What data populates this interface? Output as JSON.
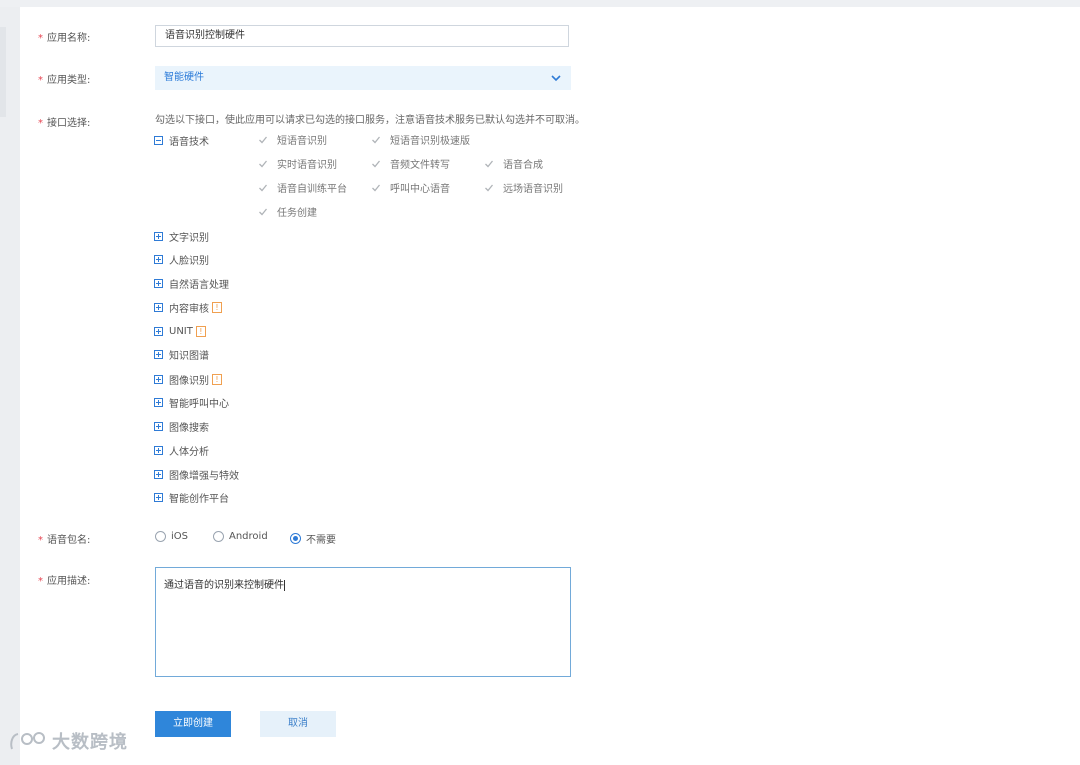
{
  "form": {
    "app_name": {
      "label": "应用名称:",
      "value": "语音识别控制硬件"
    },
    "app_type": {
      "label": "应用类型:",
      "value": "智能硬件"
    },
    "api": {
      "label": "接口选择:",
      "hint": "勾选以下接口，使此应用可以请求已勾选的接口服务，注意语音技术服务已默认勾选并不可取消。",
      "voice_group": {
        "label": "语音技术",
        "items": [
          "短语音识别",
          "短语音识别极速版",
          "实时语音识别",
          "音频文件转写",
          "语音合成",
          "语音自训练平台",
          "呼叫中心语音",
          "远场语音识别",
          "任务创建"
        ]
      },
      "groups": [
        {
          "label": "文字识别"
        },
        {
          "label": "人脸识别"
        },
        {
          "label": "自然语言处理"
        },
        {
          "label": "内容审核",
          "badge": "!"
        },
        {
          "label": "UNIT",
          "badge": "!"
        },
        {
          "label": "知识图谱"
        },
        {
          "label": "图像识别",
          "badge": "!"
        },
        {
          "label": "智能呼叫中心"
        },
        {
          "label": "图像搜索"
        },
        {
          "label": "人体分析"
        },
        {
          "label": "图像增强与特效"
        },
        {
          "label": "智能创作平台"
        }
      ]
    },
    "package": {
      "label": "语音包名:",
      "options": [
        "iOS",
        "Android",
        "不需要"
      ],
      "selected": "不需要"
    },
    "description": {
      "label": "应用描述:",
      "value": "通过语音的识别来控制硬件"
    }
  },
  "buttons": {
    "create": "立即创建",
    "cancel": "取消"
  },
  "watermark": "大数跨境",
  "colors": {
    "accent": "#2f86da",
    "required": "#e64552",
    "badge": "#f0a050"
  }
}
